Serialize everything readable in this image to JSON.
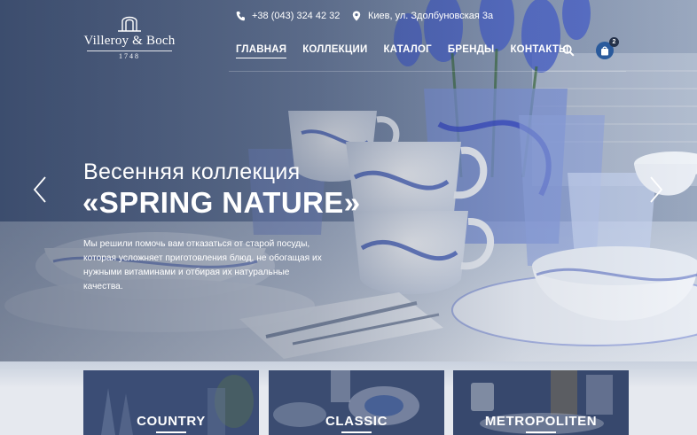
{
  "brand": {
    "name": "Villeroy & Boch",
    "year": "1748"
  },
  "contacts": {
    "phone": "+38 (043) 324 42 32",
    "address": "Киев, ул. Здолбуновская 3а"
  },
  "nav": {
    "items": [
      {
        "label": "ГЛАВНАЯ",
        "active": true
      },
      {
        "label": "КОЛЛЕКЦИИ",
        "active": false
      },
      {
        "label": "КАТАЛОГ",
        "active": false
      },
      {
        "label": "БРЕНДЫ",
        "active": false
      },
      {
        "label": "КОНТАКТЫ",
        "active": false
      }
    ]
  },
  "header_icons": {
    "search": "search-icon",
    "cart": "shopping-bag-icon",
    "cart_count": "2"
  },
  "slide": {
    "kicker": "Весенняя коллекция",
    "title": "«SPRING NATURE»",
    "description": "Мы решили помочь вам отказаться от старой посуды, которая усложняет приготовления блюд, не обогащая их нужными витаминами и отбирая их натуральные качества."
  },
  "categories": [
    {
      "label": "COUNTRY"
    },
    {
      "label": "CLASSIC"
    },
    {
      "label": "METROPOLITEN"
    }
  ],
  "colors": {
    "accent": "#2a5a9c",
    "hero_overlay": "#3a4c72",
    "text_light": "#ffffff"
  }
}
